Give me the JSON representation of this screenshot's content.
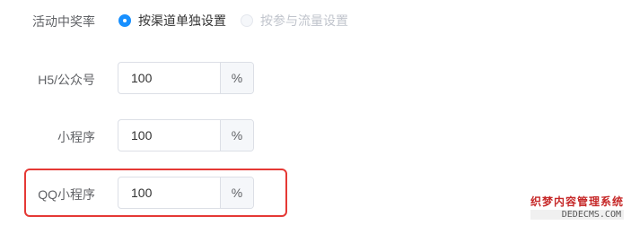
{
  "activity_rate": {
    "label": "活动中奖率",
    "options": [
      {
        "label": "按渠道单独设置",
        "checked": true,
        "disabled": false
      },
      {
        "label": "按参与流量设置",
        "checked": false,
        "disabled": true
      }
    ]
  },
  "fields": [
    {
      "label": "H5/公众号",
      "value": "100",
      "suffix": "%"
    },
    {
      "label": "小程序",
      "value": "100",
      "suffix": "%"
    },
    {
      "label": "QQ小程序",
      "value": "100",
      "suffix": "%"
    }
  ],
  "watermark": {
    "top": "织梦内容管理系统",
    "bottom": "DEDECMS.COM"
  },
  "colors": {
    "accent": "#1890ff",
    "highlight": "#e53935"
  }
}
